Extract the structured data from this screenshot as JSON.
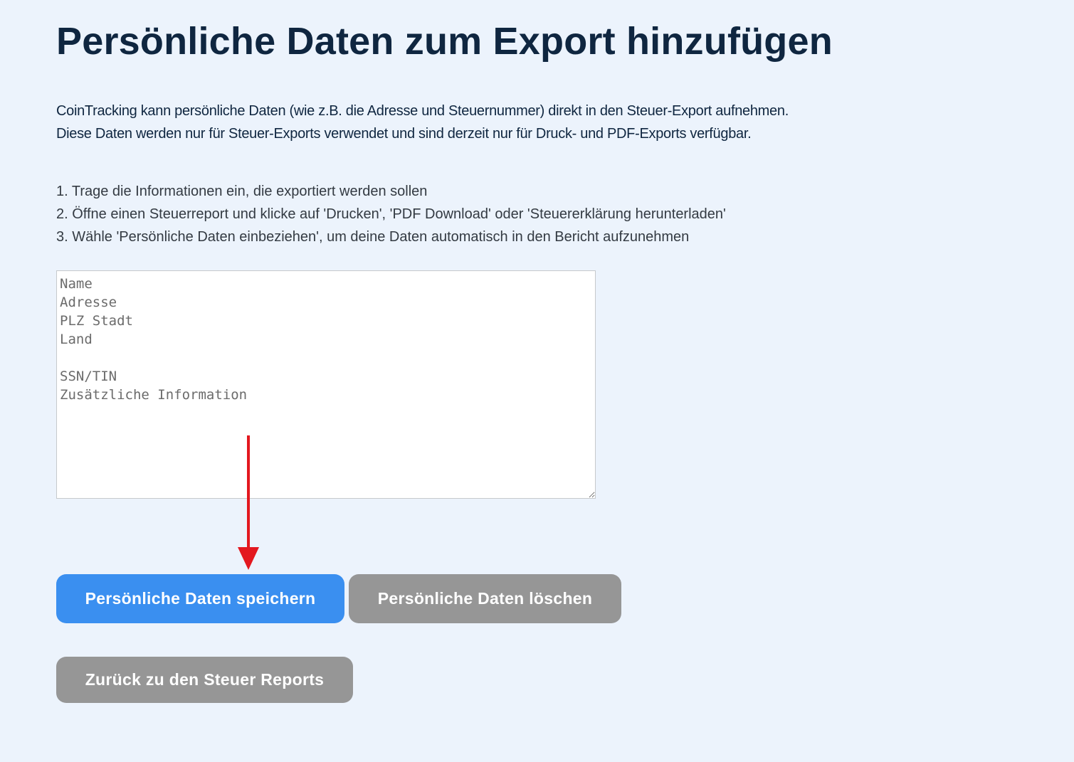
{
  "page": {
    "title": "Persönliche Daten zum Export hinzufügen"
  },
  "intro": {
    "line1": "CoinTracking kann persönliche Daten (wie z.B. die Adresse und Steuernummer) direkt in den Steuer-Export aufnehmen.",
    "line2": "Diese Daten werden nur für Steuer-Exports verwendet und sind derzeit nur für Druck- und PDF-Exports verfügbar."
  },
  "steps": [
    "1. Trage die Informationen ein, die exportiert werden sollen",
    "2. Öffne einen Steuerreport und klicke auf 'Drucken', 'PDF Download' oder 'Steuererklärung herunterladen'",
    "3. Wähle 'Persönliche Daten einbeziehen', um deine Daten automatisch in den Bericht aufzunehmen"
  ],
  "personal_data_field": {
    "placeholder": "Name\nAdresse\nPLZ Stadt\nLand\n\nSSN/TIN\nZusätzliche Information",
    "value": ""
  },
  "annotation": {
    "arrow_color": "#e3181f"
  },
  "buttons": {
    "save_label": "Persönliche Daten speichern",
    "delete_label": "Persönliche Daten löschen",
    "back_label": "Zurück zu den Steuer Reports"
  },
  "colors": {
    "background": "#ecf3fc",
    "primary_button": "#3a8ff0",
    "secondary_button": "#969696",
    "heading_text": "#0f2640"
  }
}
